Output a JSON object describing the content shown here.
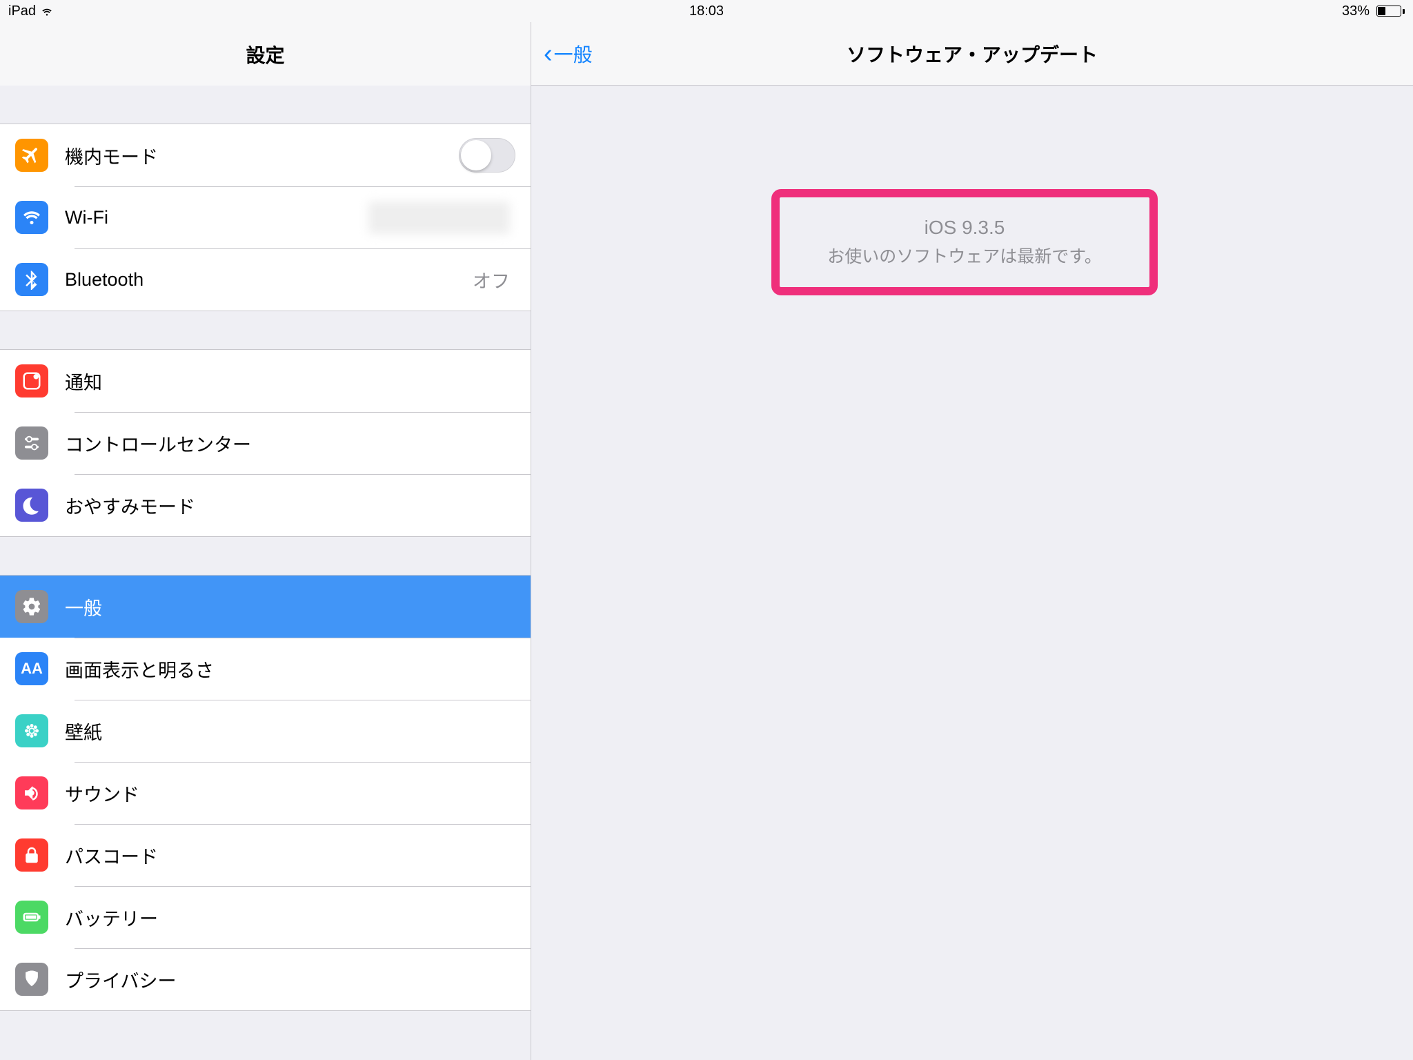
{
  "statusbar": {
    "device": "iPad",
    "time": "18:03",
    "battery_pct": "33%"
  },
  "sidebar": {
    "title": "設定",
    "group1": {
      "airplane": {
        "label": "機内モード"
      },
      "wifi": {
        "label": "Wi-Fi",
        "value": ""
      },
      "bluetooth": {
        "label": "Bluetooth",
        "value": "オフ"
      }
    },
    "group2": {
      "notifications": {
        "label": "通知"
      },
      "controlcenter": {
        "label": "コントロールセンター"
      },
      "dnd": {
        "label": "おやすみモード"
      }
    },
    "group3": {
      "general": {
        "label": "一般"
      },
      "display": {
        "label": "画面表示と明るさ"
      },
      "wallpaper": {
        "label": "壁紙"
      },
      "sound": {
        "label": "サウンド"
      },
      "passcode": {
        "label": "パスコード"
      },
      "battery": {
        "label": "バッテリー"
      },
      "privacy": {
        "label": "プライバシー"
      }
    }
  },
  "detail": {
    "back_label": "一般",
    "title": "ソフトウェア・アップデート",
    "update": {
      "version": "iOS 9.3.5",
      "message": "お使いのソフトウェアは最新です。"
    }
  }
}
